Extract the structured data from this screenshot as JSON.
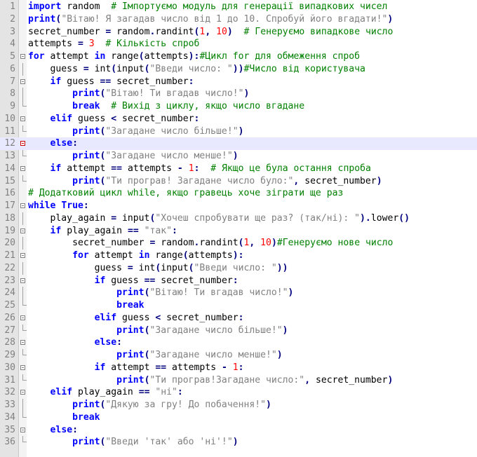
{
  "editor": {
    "current_line": 12,
    "lines": [
      {
        "n": "1",
        "t": [
          [
            "kw",
            "import"
          ],
          [
            "id",
            " random  "
          ],
          [
            "cm",
            "# Імпортуємо модуль для генерації випадкових чисел"
          ]
        ]
      },
      {
        "n": "2",
        "t": [
          [
            "kw",
            "print"
          ],
          [
            "op",
            "("
          ],
          [
            "st",
            "\"Вітаю! Я загадав число від 1 до 10. Спробуй його вгадати!\""
          ],
          [
            "op",
            ")"
          ]
        ]
      },
      {
        "n": "3",
        "t": [
          [
            "id",
            "secret_number "
          ],
          [
            "op",
            "="
          ],
          [
            "id",
            " random"
          ],
          [
            "op",
            "."
          ],
          [
            "id",
            "randint"
          ],
          [
            "op",
            "("
          ],
          [
            "nm",
            "1"
          ],
          [
            "op",
            ","
          ],
          [
            "id",
            " "
          ],
          [
            "nm",
            "10"
          ],
          [
            "op",
            ")"
          ],
          [
            "id",
            "  "
          ],
          [
            "cm",
            "# Генеруємо випадкове число"
          ]
        ]
      },
      {
        "n": "4",
        "t": [
          [
            "id",
            "attempts "
          ],
          [
            "op",
            "="
          ],
          [
            "id",
            " "
          ],
          [
            "nm",
            "3"
          ],
          [
            "id",
            "  "
          ],
          [
            "cm",
            "# Кількість спроб"
          ]
        ]
      },
      {
        "n": "5",
        "t": [
          [
            "kw",
            "for"
          ],
          [
            "id",
            " attempt "
          ],
          [
            "kw",
            "in"
          ],
          [
            "id",
            " range"
          ],
          [
            "op",
            "("
          ],
          [
            "id",
            "attempts"
          ],
          [
            "op",
            "):"
          ],
          [
            "cm",
            "#Цикл for для обмеження спроб"
          ]
        ]
      },
      {
        "n": "6",
        "t": [
          [
            "id",
            "    guess "
          ],
          [
            "op",
            "="
          ],
          [
            "id",
            " int"
          ],
          [
            "op",
            "("
          ],
          [
            "id",
            "input"
          ],
          [
            "op",
            "("
          ],
          [
            "st",
            "\"Введи число: \""
          ],
          [
            "op",
            "))"
          ],
          [
            "cm",
            "#Число від користувача"
          ]
        ]
      },
      {
        "n": "7",
        "t": [
          [
            "id",
            "    "
          ],
          [
            "kw",
            "if"
          ],
          [
            "id",
            " guess "
          ],
          [
            "op",
            "=="
          ],
          [
            "id",
            " secret_number"
          ],
          [
            "op",
            ":"
          ]
        ]
      },
      {
        "n": "8",
        "t": [
          [
            "id",
            "        "
          ],
          [
            "kw",
            "print"
          ],
          [
            "op",
            "("
          ],
          [
            "st",
            "\"Вітаю! Ти вгадав число!\""
          ],
          [
            "op",
            ")"
          ]
        ]
      },
      {
        "n": "9",
        "t": [
          [
            "id",
            "        "
          ],
          [
            "kw",
            "break"
          ],
          [
            "id",
            "  "
          ],
          [
            "cm",
            "# Вихід з циклу, якщо число вгадане"
          ]
        ]
      },
      {
        "n": "10",
        "t": [
          [
            "id",
            "    "
          ],
          [
            "kw",
            "elif"
          ],
          [
            "id",
            " guess "
          ],
          [
            "op",
            "<"
          ],
          [
            "id",
            " secret_number"
          ],
          [
            "op",
            ":"
          ]
        ]
      },
      {
        "n": "11",
        "t": [
          [
            "id",
            "        "
          ],
          [
            "kw",
            "print"
          ],
          [
            "op",
            "("
          ],
          [
            "st",
            "\"Загадане число більше!\""
          ],
          [
            "op",
            ")"
          ]
        ]
      },
      {
        "n": "12",
        "t": [
          [
            "id",
            "    "
          ],
          [
            "kw",
            "else"
          ],
          [
            "op",
            ":"
          ]
        ]
      },
      {
        "n": "13",
        "t": [
          [
            "id",
            "        "
          ],
          [
            "kw",
            "print"
          ],
          [
            "op",
            "("
          ],
          [
            "st",
            "\"Загадане число менше!\""
          ],
          [
            "op",
            ")"
          ]
        ]
      },
      {
        "n": "14",
        "t": [
          [
            "id",
            "    "
          ],
          [
            "kw",
            "if"
          ],
          [
            "id",
            " attempt "
          ],
          [
            "op",
            "=="
          ],
          [
            "id",
            " attempts "
          ],
          [
            "op",
            "-"
          ],
          [
            "id",
            " "
          ],
          [
            "nm",
            "1"
          ],
          [
            "op",
            ":"
          ],
          [
            "id",
            "  "
          ],
          [
            "cm",
            "# Якщо це була остання спроба"
          ]
        ]
      },
      {
        "n": "15",
        "t": [
          [
            "id",
            "        "
          ],
          [
            "kw",
            "print"
          ],
          [
            "op",
            "("
          ],
          [
            "st",
            "\"Ти програв! Загадане число було:\""
          ],
          [
            "op",
            ","
          ],
          [
            "id",
            " secret_number"
          ],
          [
            "op",
            ")"
          ]
        ]
      },
      {
        "n": "16",
        "t": [
          [
            "cm",
            "# Додатковий цикл while, якщо гравець хоче зіграти ще раз"
          ]
        ]
      },
      {
        "n": "17",
        "t": [
          [
            "kw",
            "while"
          ],
          [
            "id",
            " "
          ],
          [
            "kw",
            "True"
          ],
          [
            "op",
            ":"
          ]
        ]
      },
      {
        "n": "18",
        "t": [
          [
            "id",
            "    play_again "
          ],
          [
            "op",
            "="
          ],
          [
            "id",
            " input"
          ],
          [
            "op",
            "("
          ],
          [
            "st",
            "\"Хочеш спробувати ще раз? (так/ні): \""
          ],
          [
            "op",
            ")."
          ],
          [
            "id",
            "lower"
          ],
          [
            "op",
            "()"
          ]
        ]
      },
      {
        "n": "19",
        "t": [
          [
            "id",
            "    "
          ],
          [
            "kw",
            "if"
          ],
          [
            "id",
            " play_again "
          ],
          [
            "op",
            "=="
          ],
          [
            "id",
            " "
          ],
          [
            "st",
            "\"так\""
          ],
          [
            "op",
            ":"
          ]
        ]
      },
      {
        "n": "20",
        "t": [
          [
            "id",
            "        secret_number "
          ],
          [
            "op",
            "="
          ],
          [
            "id",
            " random"
          ],
          [
            "op",
            "."
          ],
          [
            "id",
            "randint"
          ],
          [
            "op",
            "("
          ],
          [
            "nm",
            "1"
          ],
          [
            "op",
            ","
          ],
          [
            "id",
            " "
          ],
          [
            "nm",
            "10"
          ],
          [
            "op",
            ")"
          ],
          [
            "cm",
            "#Генеруємо нове число"
          ]
        ]
      },
      {
        "n": "21",
        "t": [
          [
            "id",
            "        "
          ],
          [
            "kw",
            "for"
          ],
          [
            "id",
            " attempt "
          ],
          [
            "kw",
            "in"
          ],
          [
            "id",
            " range"
          ],
          [
            "op",
            "("
          ],
          [
            "id",
            "attempts"
          ],
          [
            "op",
            "):"
          ]
        ]
      },
      {
        "n": "22",
        "t": [
          [
            "id",
            "            guess "
          ],
          [
            "op",
            "="
          ],
          [
            "id",
            " int"
          ],
          [
            "op",
            "("
          ],
          [
            "id",
            "input"
          ],
          [
            "op",
            "("
          ],
          [
            "st",
            "\"Введи число: \""
          ],
          [
            "op",
            "))"
          ]
        ]
      },
      {
        "n": "23",
        "t": [
          [
            "id",
            "            "
          ],
          [
            "kw",
            "if"
          ],
          [
            "id",
            " guess "
          ],
          [
            "op",
            "=="
          ],
          [
            "id",
            " secret_number"
          ],
          [
            "op",
            ":"
          ]
        ]
      },
      {
        "n": "24",
        "t": [
          [
            "id",
            "                "
          ],
          [
            "kw",
            "print"
          ],
          [
            "op",
            "("
          ],
          [
            "st",
            "\"Вітаю! Ти вгадав число!\""
          ],
          [
            "op",
            ")"
          ]
        ]
      },
      {
        "n": "25",
        "t": [
          [
            "id",
            "                "
          ],
          [
            "kw",
            "break"
          ]
        ]
      },
      {
        "n": "26",
        "t": [
          [
            "id",
            "            "
          ],
          [
            "kw",
            "elif"
          ],
          [
            "id",
            " guess "
          ],
          [
            "op",
            "<"
          ],
          [
            "id",
            " secret_number"
          ],
          [
            "op",
            ":"
          ]
        ]
      },
      {
        "n": "27",
        "t": [
          [
            "id",
            "                "
          ],
          [
            "kw",
            "print"
          ],
          [
            "op",
            "("
          ],
          [
            "st",
            "\"Загадане число більше!\""
          ],
          [
            "op",
            ")"
          ]
        ]
      },
      {
        "n": "28",
        "t": [
          [
            "id",
            "            "
          ],
          [
            "kw",
            "else"
          ],
          [
            "op",
            ":"
          ]
        ]
      },
      {
        "n": "29",
        "t": [
          [
            "id",
            "                "
          ],
          [
            "kw",
            "print"
          ],
          [
            "op",
            "("
          ],
          [
            "st",
            "\"Загадане число менше!\""
          ],
          [
            "op",
            ")"
          ]
        ]
      },
      {
        "n": "30",
        "t": [
          [
            "id",
            "            "
          ],
          [
            "kw",
            "if"
          ],
          [
            "id",
            " attempt "
          ],
          [
            "op",
            "=="
          ],
          [
            "id",
            " attempts "
          ],
          [
            "op",
            "-"
          ],
          [
            "id",
            " "
          ],
          [
            "nm",
            "1"
          ],
          [
            "op",
            ":"
          ]
        ]
      },
      {
        "n": "31",
        "t": [
          [
            "id",
            "                "
          ],
          [
            "kw",
            "print"
          ],
          [
            "op",
            "("
          ],
          [
            "st",
            "\"Ти програв!Загадане число:\""
          ],
          [
            "op",
            ","
          ],
          [
            "id",
            " secret_number"
          ],
          [
            "op",
            ")"
          ]
        ]
      },
      {
        "n": "32",
        "t": [
          [
            "id",
            "    "
          ],
          [
            "kw",
            "elif"
          ],
          [
            "id",
            " play_again "
          ],
          [
            "op",
            "=="
          ],
          [
            "id",
            " "
          ],
          [
            "st",
            "\"ні\""
          ],
          [
            "op",
            ":"
          ]
        ]
      },
      {
        "n": "33",
        "t": [
          [
            "id",
            "        "
          ],
          [
            "kw",
            "print"
          ],
          [
            "op",
            "("
          ],
          [
            "st",
            "\"Дякую за гру! До побачення!\""
          ],
          [
            "op",
            ")"
          ]
        ]
      },
      {
        "n": "34",
        "t": [
          [
            "id",
            "        "
          ],
          [
            "kw",
            "break"
          ]
        ]
      },
      {
        "n": "35",
        "t": [
          [
            "id",
            "    "
          ],
          [
            "kw",
            "else"
          ],
          [
            "op",
            ":"
          ]
        ]
      },
      {
        "n": "36",
        "t": [
          [
            "id",
            "        "
          ],
          [
            "kw",
            "print"
          ],
          [
            "op",
            "("
          ],
          [
            "st",
            "\"Введи 'так' або 'ні'!\""
          ],
          [
            "op",
            ")"
          ]
        ]
      }
    ]
  },
  "colors": {
    "keyword": "#0000ff",
    "string": "#808080",
    "number": "#ff0000",
    "comment": "#008000",
    "operator": "#000080",
    "current_line": "#e8e8ff"
  }
}
